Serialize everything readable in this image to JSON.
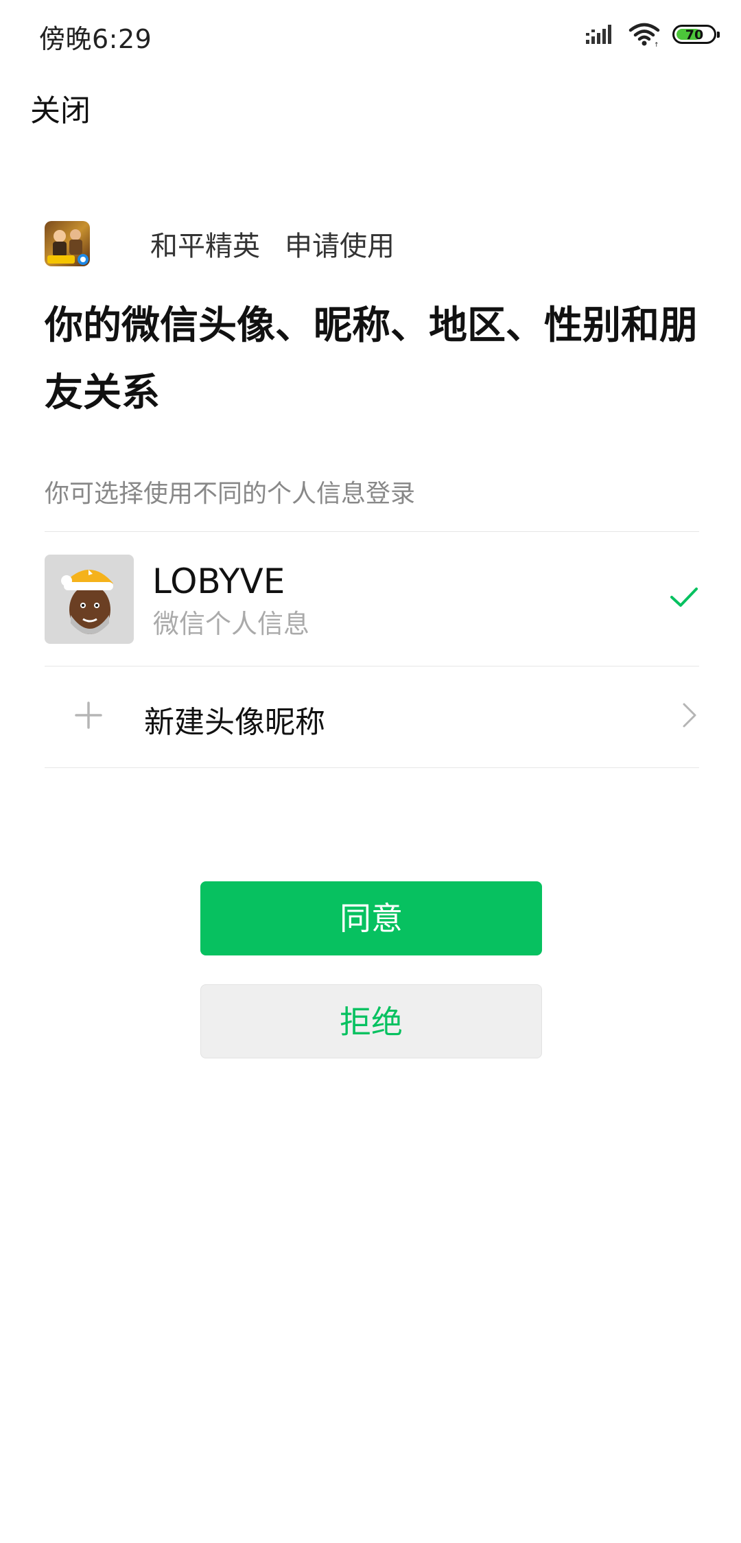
{
  "status_bar": {
    "time": "傍晚6:29",
    "battery_level": "70",
    "battery_fraction": 0.7,
    "icons": [
      "signal-icon",
      "wifi-icon",
      "battery-icon"
    ]
  },
  "header": {
    "close_label": "关闭"
  },
  "app": {
    "name": "和平精英",
    "request_label": "申请使用"
  },
  "permission": {
    "headline": "你的微信头像、昵称、地区、性别和朋友关系",
    "subtitle": "你可选择使用不同的个人信息登录"
  },
  "profile": {
    "name": "LOBYVE",
    "description": "微信个人信息",
    "selected": true
  },
  "new_profile": {
    "label": "新建头像昵称"
  },
  "actions": {
    "agree_label": "同意",
    "reject_label": "拒绝"
  },
  "colors": {
    "accent": "#07c160",
    "text_primary": "#111111",
    "text_secondary": "#888888",
    "battery_green": "#4cc63a"
  }
}
